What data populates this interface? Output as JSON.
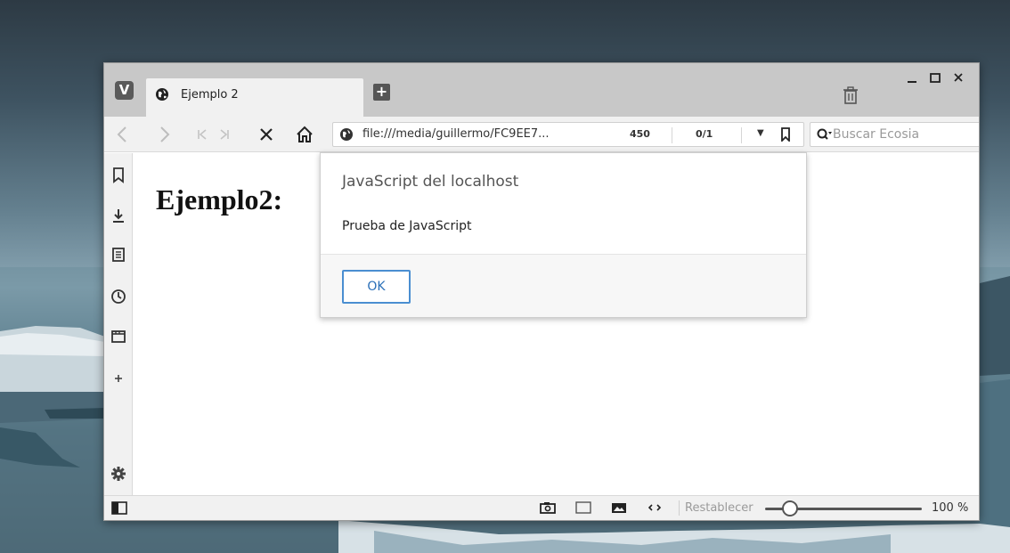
{
  "tab": {
    "title": "Ejemplo 2"
  },
  "address": {
    "url": "file:///media/guillermo/FC9EE7...",
    "count": "450",
    "ratio": "0/1"
  },
  "search": {
    "placeholder": "Buscar Ecosia"
  },
  "page": {
    "heading": "Ejemplo2:"
  },
  "dialog": {
    "title": "JavaScript del localhost",
    "message": "Prueba de JavaScript",
    "ok_label": "OK"
  },
  "status": {
    "reset_label": "Restablecer",
    "zoom_label": "100 %",
    "zoom_fraction": 0.16
  },
  "colors": {
    "accent": "#4a8ed1",
    "chrome": "#f1f1f1",
    "titlebar": "#c8c8c8"
  },
  "icons": {
    "titlebar": [
      "vivaldi-logo-icon",
      "globe-icon",
      "new-tab-icon",
      "trash-icon",
      "minimize-icon",
      "maximize-icon",
      "close-icon"
    ],
    "toolbar": [
      "back-icon",
      "forward-icon",
      "rewind-icon",
      "fast-forward-icon",
      "stop-icon",
      "home-icon",
      "site-info-icon",
      "dropdown-icon",
      "bookmark-icon",
      "search-engine-icon"
    ],
    "sidebar": [
      "bookmarks-icon",
      "downloads-icon",
      "notes-icon",
      "history-icon",
      "window-icon",
      "add-panel-icon",
      "settings-icon"
    ],
    "statusbar": [
      "panel-toggle-icon",
      "camera-icon",
      "tile-icon",
      "image-icon",
      "code-icon"
    ]
  }
}
